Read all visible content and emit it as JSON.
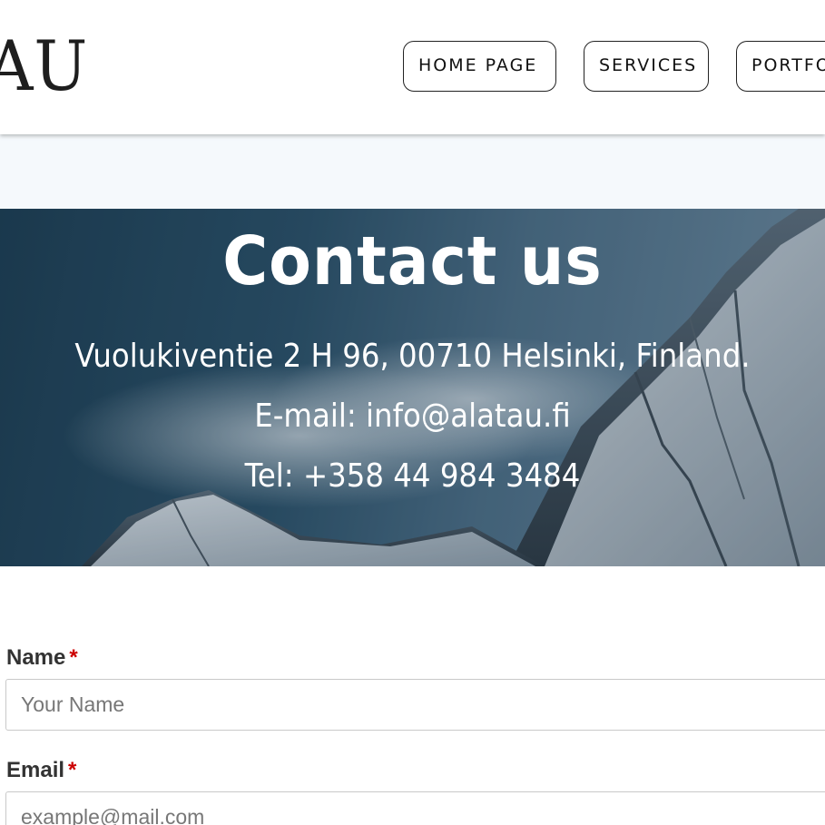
{
  "header": {
    "logo_text": "AU",
    "nav": [
      {
        "label": "HOME PAGE"
      },
      {
        "label": "SERVICES"
      },
      {
        "label": "PORTFO"
      }
    ]
  },
  "hero": {
    "title": "Contact us",
    "address": "Vuolukiventie 2 H 96, 00710 Helsinki, Finland.",
    "email_line": "E-mail: info@alatau.fi",
    "tel_line": "Tel: +358 44 984 3484"
  },
  "form": {
    "name": {
      "label": "Name",
      "required_mark": "*",
      "placeholder": "Your Name",
      "value": ""
    },
    "email": {
      "label": "Email",
      "required_mark": "*",
      "placeholder": "example@mail.com",
      "value": ""
    }
  },
  "colors": {
    "required": "#cc0000",
    "band": "#f5f9fc",
    "hero_sky": "#2b5068",
    "text_dark": "#333333"
  },
  "icons": {}
}
